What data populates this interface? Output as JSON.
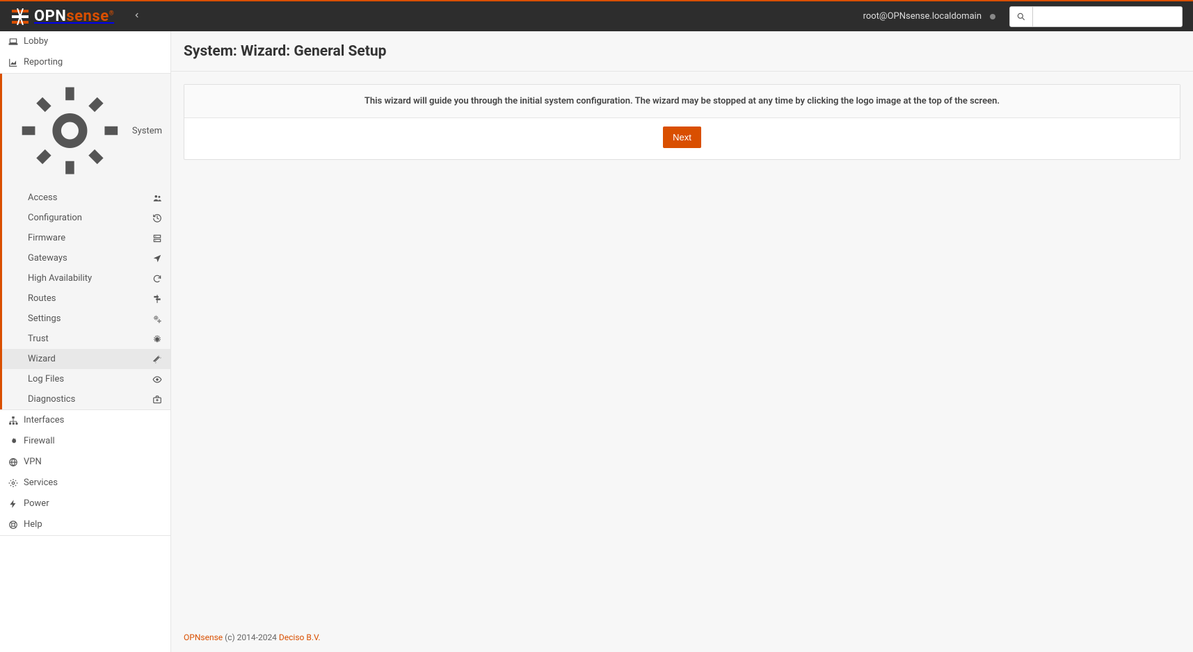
{
  "brand": {
    "opn": "OPN",
    "sense": "sense"
  },
  "header": {
    "user": "root@OPNsense.localdomain",
    "search_placeholder": ""
  },
  "sidebar": {
    "top": [
      {
        "label": "Lobby",
        "icon": "laptop"
      },
      {
        "label": "Reporting",
        "icon": "area-chart"
      }
    ],
    "system": {
      "label": "System",
      "icon": "cogs-mini",
      "items": [
        {
          "label": "Access",
          "icon": "users"
        },
        {
          "label": "Configuration",
          "icon": "history"
        },
        {
          "label": "Firmware",
          "icon": "server"
        },
        {
          "label": "Gateways",
          "icon": "location-arrow"
        },
        {
          "label": "High Availability",
          "icon": "refresh"
        },
        {
          "label": "Routes",
          "icon": "signs"
        },
        {
          "label": "Settings",
          "icon": "cogs"
        },
        {
          "label": "Trust",
          "icon": "certificate"
        },
        {
          "label": "Wizard",
          "icon": "magic",
          "active": true
        },
        {
          "label": "Log Files",
          "icon": "eye"
        },
        {
          "label": "Diagnostics",
          "icon": "medkit"
        }
      ]
    },
    "bottom": [
      {
        "label": "Interfaces",
        "icon": "sitemap"
      },
      {
        "label": "Firewall",
        "icon": "fire"
      },
      {
        "label": "VPN",
        "icon": "globe"
      },
      {
        "label": "Services",
        "icon": "gear"
      },
      {
        "label": "Power",
        "icon": "bolt"
      },
      {
        "label": "Help",
        "icon": "life-ring"
      }
    ]
  },
  "page": {
    "title": "System: Wizard: General Setup",
    "wizard_intro": "This wizard will guide you through the initial system configuration. The wizard may be stopped at any time by clicking the logo image at the top of the screen.",
    "next_label": "Next"
  },
  "footer": {
    "product": "OPNsense",
    "copyright": " (c) 2014-2024 ",
    "company": "Deciso B.V."
  }
}
